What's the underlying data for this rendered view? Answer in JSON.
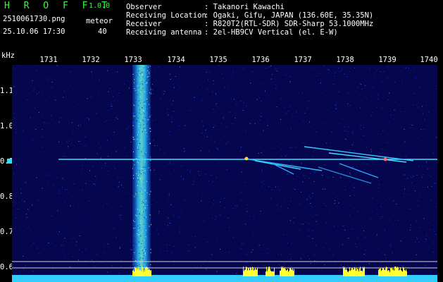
{
  "header": {
    "app_title": "H R O F F T",
    "app_version": "1.0.0",
    "filename": "2510061730.png",
    "timestamp": "25.10.06 17:30",
    "meteor_label": "meteor",
    "meteor_count": "40",
    "observer_label": "Observer",
    "observer_value": ": Takanori Kawachi",
    "location_label": "Receiving Location",
    "location_value": ": Ogaki, Gifu, JAPAN (136.60E, 35.35N)",
    "receiver_label": "Receiver",
    "receiver_value": ": R820T2(RTL-SDR) SDR-Sharp 53.1000MHz",
    "antenna_label": "Receiving antenna",
    "antenna_value": ": 2el-HB9CV Vertical (el. E-W)"
  },
  "axis": {
    "y_unit": "kHz",
    "x_ticks": [
      "1731",
      "1732",
      "1733",
      "1734",
      "1735",
      "1736",
      "1737",
      "1738",
      "1739",
      "1740"
    ],
    "y_ticks": [
      "1.1",
      "1.0",
      "0.9",
      "0.8",
      "0.7",
      "0.6"
    ]
  },
  "colors": {
    "background": "#000000",
    "spectrogram_bg": "#06064f",
    "title_green": "#33ff33",
    "signal_cyan": "#33ddff",
    "level_yellow": "#ffff33"
  }
}
